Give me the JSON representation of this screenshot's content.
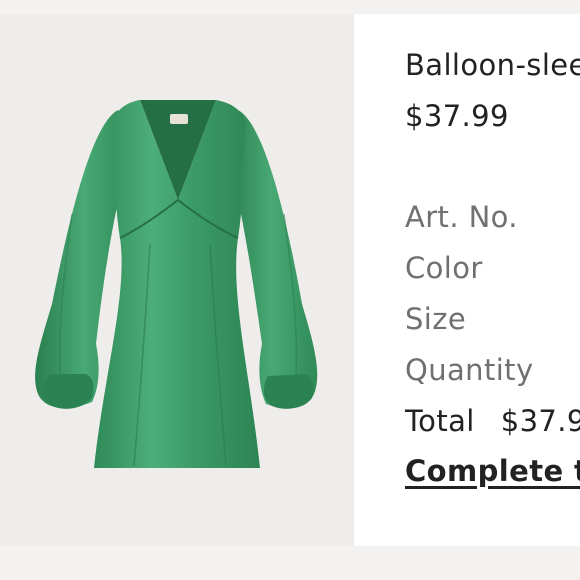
{
  "product": {
    "title": "Balloon-slee",
    "price": "$37.99",
    "image_description": "green satin balloon-sleeve dress",
    "dress_color": "#3a9a66"
  },
  "details": {
    "art_no_label": "Art. No.",
    "color_label": "Color",
    "size_label": "Size",
    "quantity_label": "Quantity",
    "total_label": "Total",
    "total_value": "$37.9"
  },
  "actions": {
    "complete_label": "Complete t"
  }
}
